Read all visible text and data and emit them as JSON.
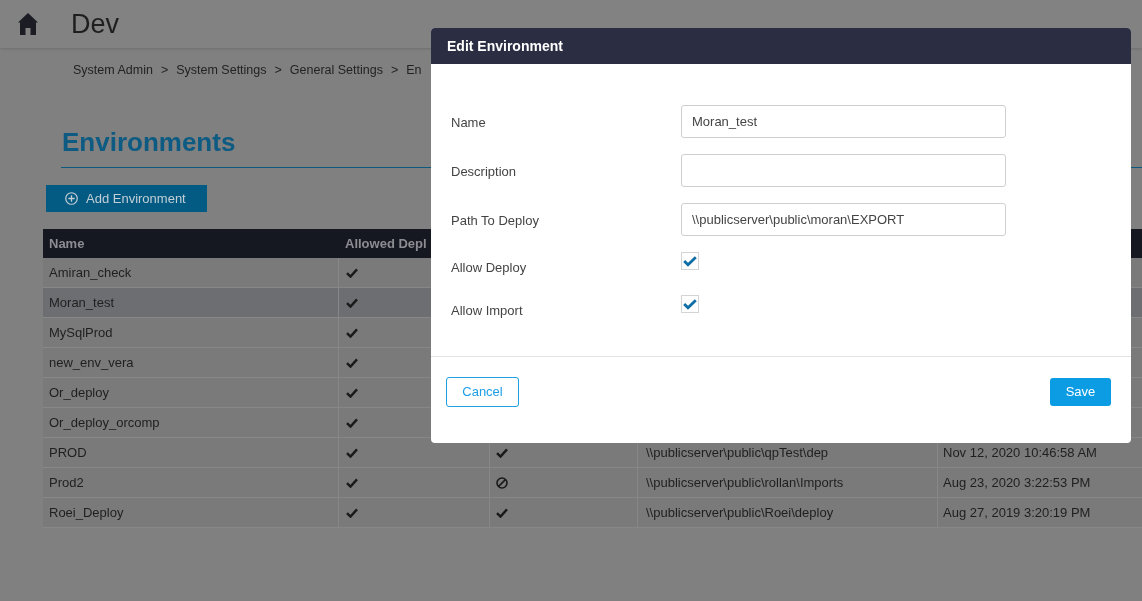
{
  "header": {
    "title": "Dev"
  },
  "breadcrumb": [
    {
      "label": "System Admin",
      "separator": ">"
    },
    {
      "label": "System Settings",
      "separator": ">"
    },
    {
      "label": "General Settings",
      "separator": ">"
    },
    {
      "label": "En"
    }
  ],
  "page": {
    "title": "Environments",
    "add_button": "Add Environment"
  },
  "table": {
    "columns": [
      "Name",
      "Allowed Depl"
    ],
    "rows": [
      {
        "name": "Amiran_check",
        "selected": false,
        "column_2_allowed": true
      },
      {
        "name": "Moran_test",
        "selected": true,
        "column_2_allowed": true
      },
      {
        "name": "MySqlProd",
        "selected": false,
        "column_2_allowed": true
      },
      {
        "name": "new_env_vera",
        "selected": false,
        "column_2_allowed": true
      },
      {
        "name": "Or_deploy",
        "selected": false,
        "column_2_allowed": true
      },
      {
        "name": "Or_deploy_orcomp",
        "selected": false,
        "column_2_allowed": true
      },
      {
        "name": "PROD",
        "selected": false,
        "column_2_allowed": true,
        "column_3_allowed": true,
        "column_4": "\\\\publicserver\\public\\qpTest\\dep",
        "column_5": "Nov 12, 2020 10:46:58 AM"
      },
      {
        "name": "Prod2",
        "selected": false,
        "column_2_allowed": true,
        "column_3_allowed": false,
        "column_4": "\\\\publicserver\\public\\rollan\\Imports",
        "column_5": "Aug 23, 2020 3:22:53 PM"
      },
      {
        "name": "Roei_Deploy",
        "selected": false,
        "column_2_allowed": true,
        "column_3_allowed": true,
        "column_4": "\\\\publicserver\\public\\Roei\\deploy",
        "column_5": "Aug 27, 2019 3:20:19 PM"
      }
    ]
  },
  "dialog": {
    "title": "Edit Environment",
    "fields": [
      {
        "kind": "text",
        "label": "Name",
        "value": "Moran_test"
      },
      {
        "kind": "text",
        "label": "Description"
      },
      {
        "kind": "text",
        "label": "Path To Deploy",
        "value": "\\\\publicserver\\public\\moran\\EXPORT"
      },
      {
        "kind": "checkbox",
        "label": "Allow Deploy",
        "checked": true
      },
      {
        "kind": "checkbox",
        "label": "Allow Import",
        "checked": true
      }
    ],
    "buttons": [
      {
        "kind": "secondary",
        "label": "Cancel"
      },
      {
        "kind": "primary",
        "label": "Save"
      }
    ]
  }
}
